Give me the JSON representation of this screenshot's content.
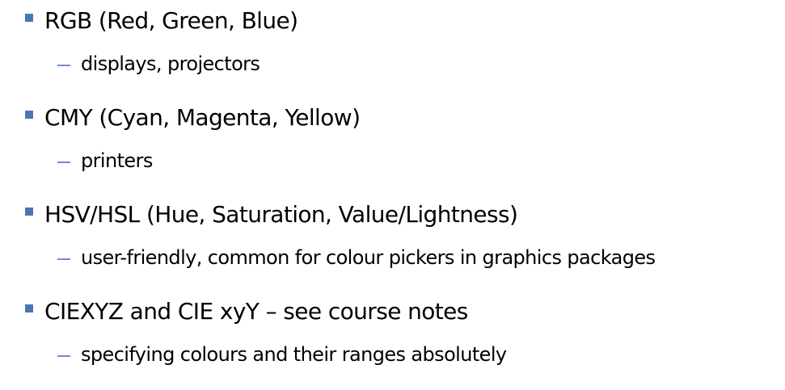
{
  "bullets": [
    {
      "text": "RGB (Red, Green, Blue)",
      "sub": "displays, projectors"
    },
    {
      "text": "CMY (Cyan, Magenta, Yellow)",
      "sub": "printers"
    },
    {
      "text": "HSV/HSL (Hue, Saturation, Value/Lightness)",
      "sub": "user-friendly, common for colour pickers in graphics packages"
    },
    {
      "text": "CIEXYZ and CIE xyY – see course notes",
      "sub": "specifying colours and their ranges absolutely"
    }
  ],
  "colors": {
    "bullet_marker": "#4a77b4",
    "sub_dash": "#6d8fc4",
    "text": "#000000",
    "background": "#ffffff"
  },
  "icons": {
    "bullet": "square-bullet-icon",
    "sub_bullet": "dash-bullet-icon"
  }
}
